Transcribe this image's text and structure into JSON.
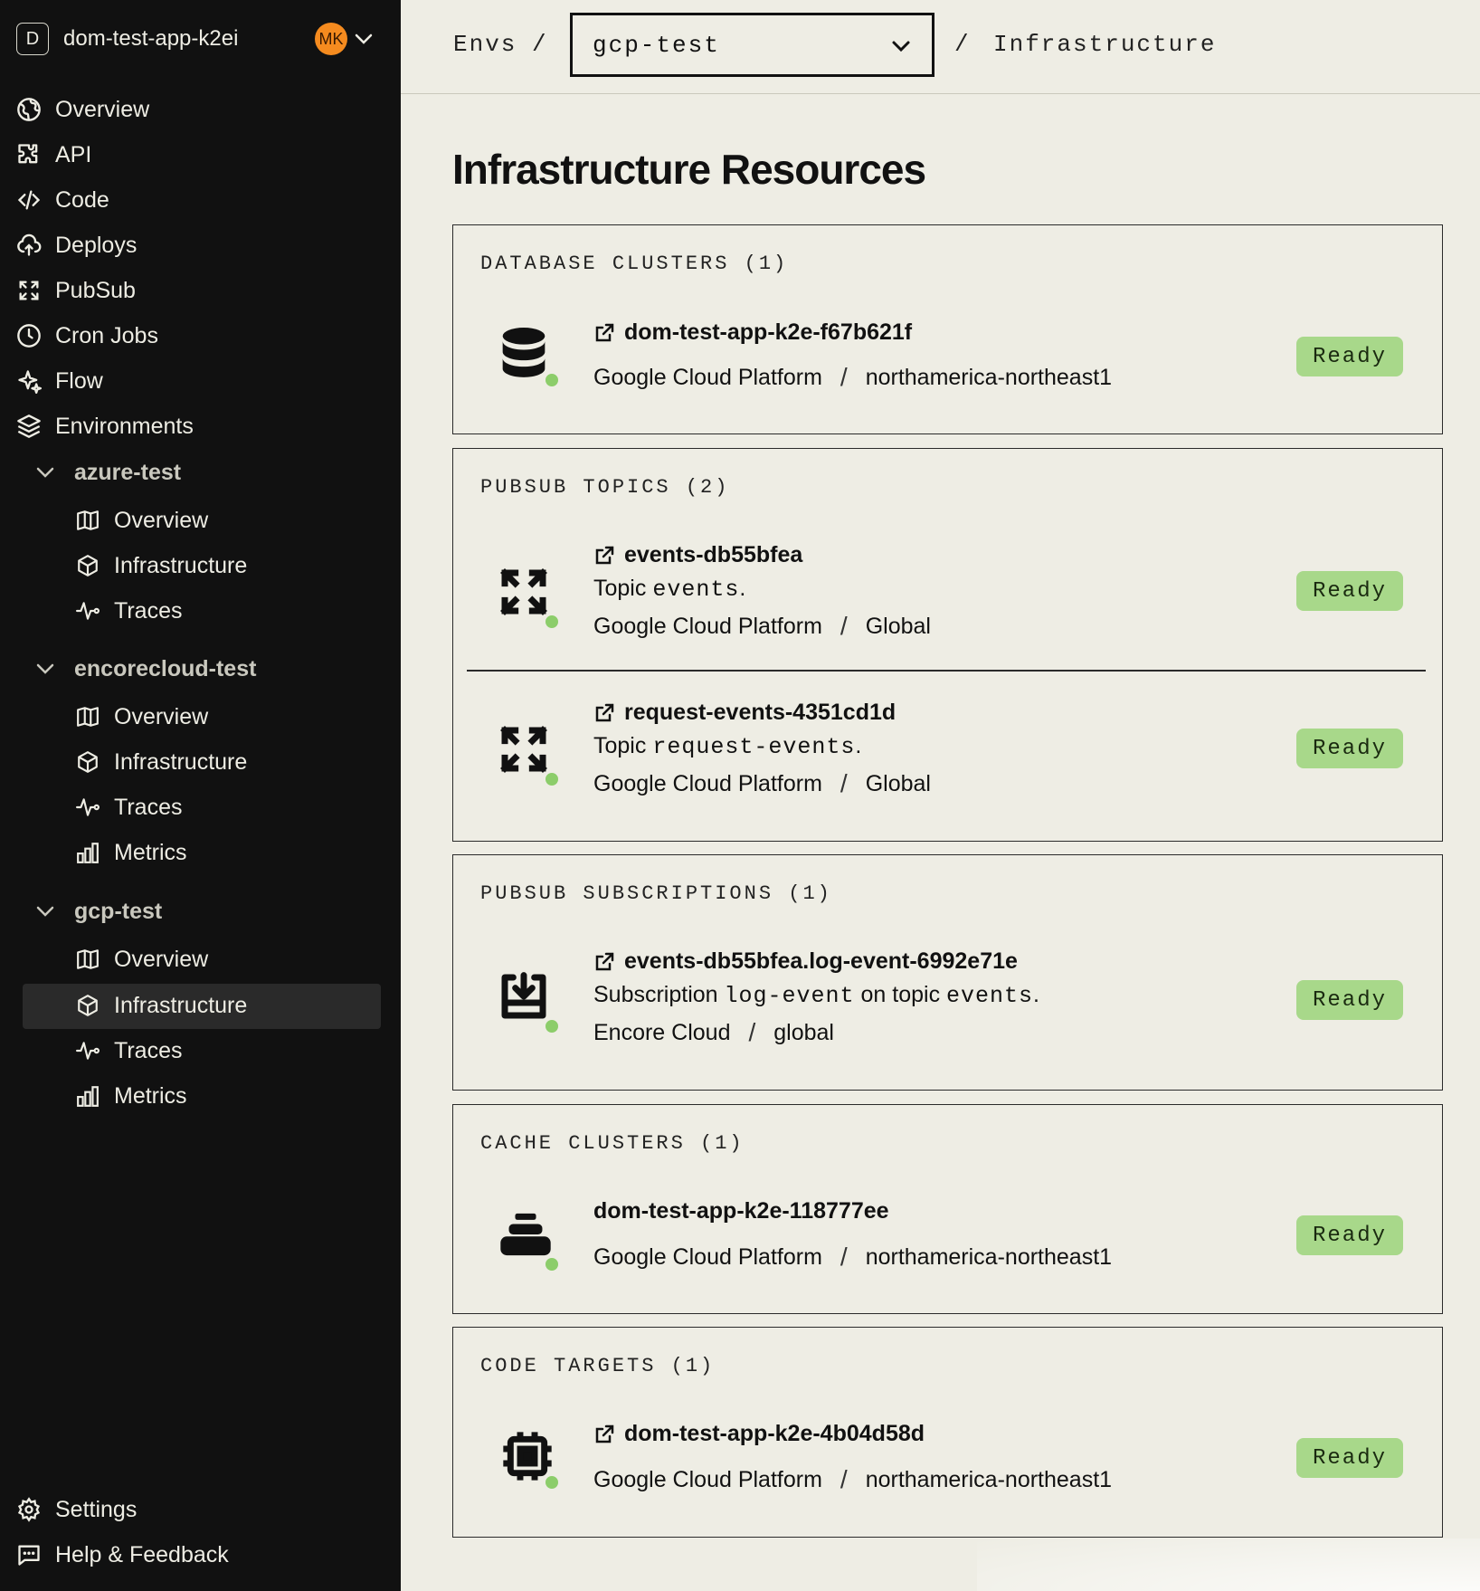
{
  "app": {
    "badge": "D",
    "name": "dom-test-app-k2ei",
    "avatar": "MK"
  },
  "nav": {
    "overview": "Overview",
    "api": "API",
    "code": "Code",
    "deploys": "Deploys",
    "pubsub": "PubSub",
    "cron": "Cron Jobs",
    "flow": "Flow",
    "environments": "Environments",
    "settings": "Settings",
    "help": "Help & Feedback"
  },
  "envs": [
    {
      "name": "azure-test",
      "items": [
        "Overview",
        "Infrastructure",
        "Traces"
      ]
    },
    {
      "name": "encorecloud-test",
      "items": [
        "Overview",
        "Infrastructure",
        "Traces",
        "Metrics"
      ]
    },
    {
      "name": "gcp-test",
      "items": [
        "Overview",
        "Infrastructure",
        "Traces",
        "Metrics"
      ],
      "active": "Infrastructure"
    }
  ],
  "header": {
    "envs": "Envs",
    "selected_env": "gcp-test",
    "current": "Infrastructure"
  },
  "page_title": "Infrastructure Resources",
  "sections": {
    "db": {
      "title": "DATABASE CLUSTERS (1)",
      "r0": {
        "name": "dom-test-app-k2e-f67b621f",
        "provider": "Google Cloud Platform",
        "region": "northamerica-northeast1",
        "status": "Ready"
      }
    },
    "topics": {
      "title": "PUBSUB TOPICS (2)",
      "r0": {
        "name": "events-db55bfea",
        "desc_prefix": "Topic",
        "desc_code": "events",
        "desc_suffix": ".",
        "provider": "Google Cloud Platform",
        "region": "Global",
        "status": "Ready"
      },
      "r1": {
        "name": "request-events-4351cd1d",
        "desc_prefix": "Topic",
        "desc_code": "request-events",
        "desc_suffix": ".",
        "provider": "Google Cloud Platform",
        "region": "Global",
        "status": "Ready"
      }
    },
    "subs": {
      "title": "PUBSUB SUBSCRIPTIONS (1)",
      "r0": {
        "name": "events-db55bfea.log-event-6992e71e",
        "desc_prefix": "Subscription",
        "desc_code": "log-event",
        "desc_mid": "on topic",
        "desc_code2": "events",
        "desc_suffix": ".",
        "provider": "Encore Cloud",
        "region": "global",
        "status": "Ready"
      }
    },
    "cache": {
      "title": "CACHE CLUSTERS (1)",
      "r0": {
        "name": "dom-test-app-k2e-118777ee",
        "provider": "Google Cloud Platform",
        "region": "northamerica-northeast1",
        "status": "Ready"
      }
    },
    "code": {
      "title": "CODE TARGETS (1)",
      "r0": {
        "name": "dom-test-app-k2e-4b04d58d",
        "provider": "Google Cloud Platform",
        "region": "northamerica-northeast1",
        "status": "Ready"
      }
    }
  },
  "colors": {
    "sidebar_bg": "#111111",
    "page_bg": "#eeede4",
    "ready_badge": "#a8d88a",
    "status_dot": "#8ccd6a",
    "avatar": "#f58b1f"
  },
  "icons": [
    "globe-icon",
    "puzzle-icon",
    "code-icon",
    "upload-cloud-icon",
    "pubsub-icon",
    "clock-icon",
    "sparkles-icon",
    "layers-icon",
    "map-icon",
    "cube-icon",
    "activity-icon",
    "bar-chart-icon",
    "settings-icon",
    "help-icon",
    "external-link-icon",
    "database-icon",
    "cache-icon",
    "subscription-icon",
    "chip-icon"
  ]
}
